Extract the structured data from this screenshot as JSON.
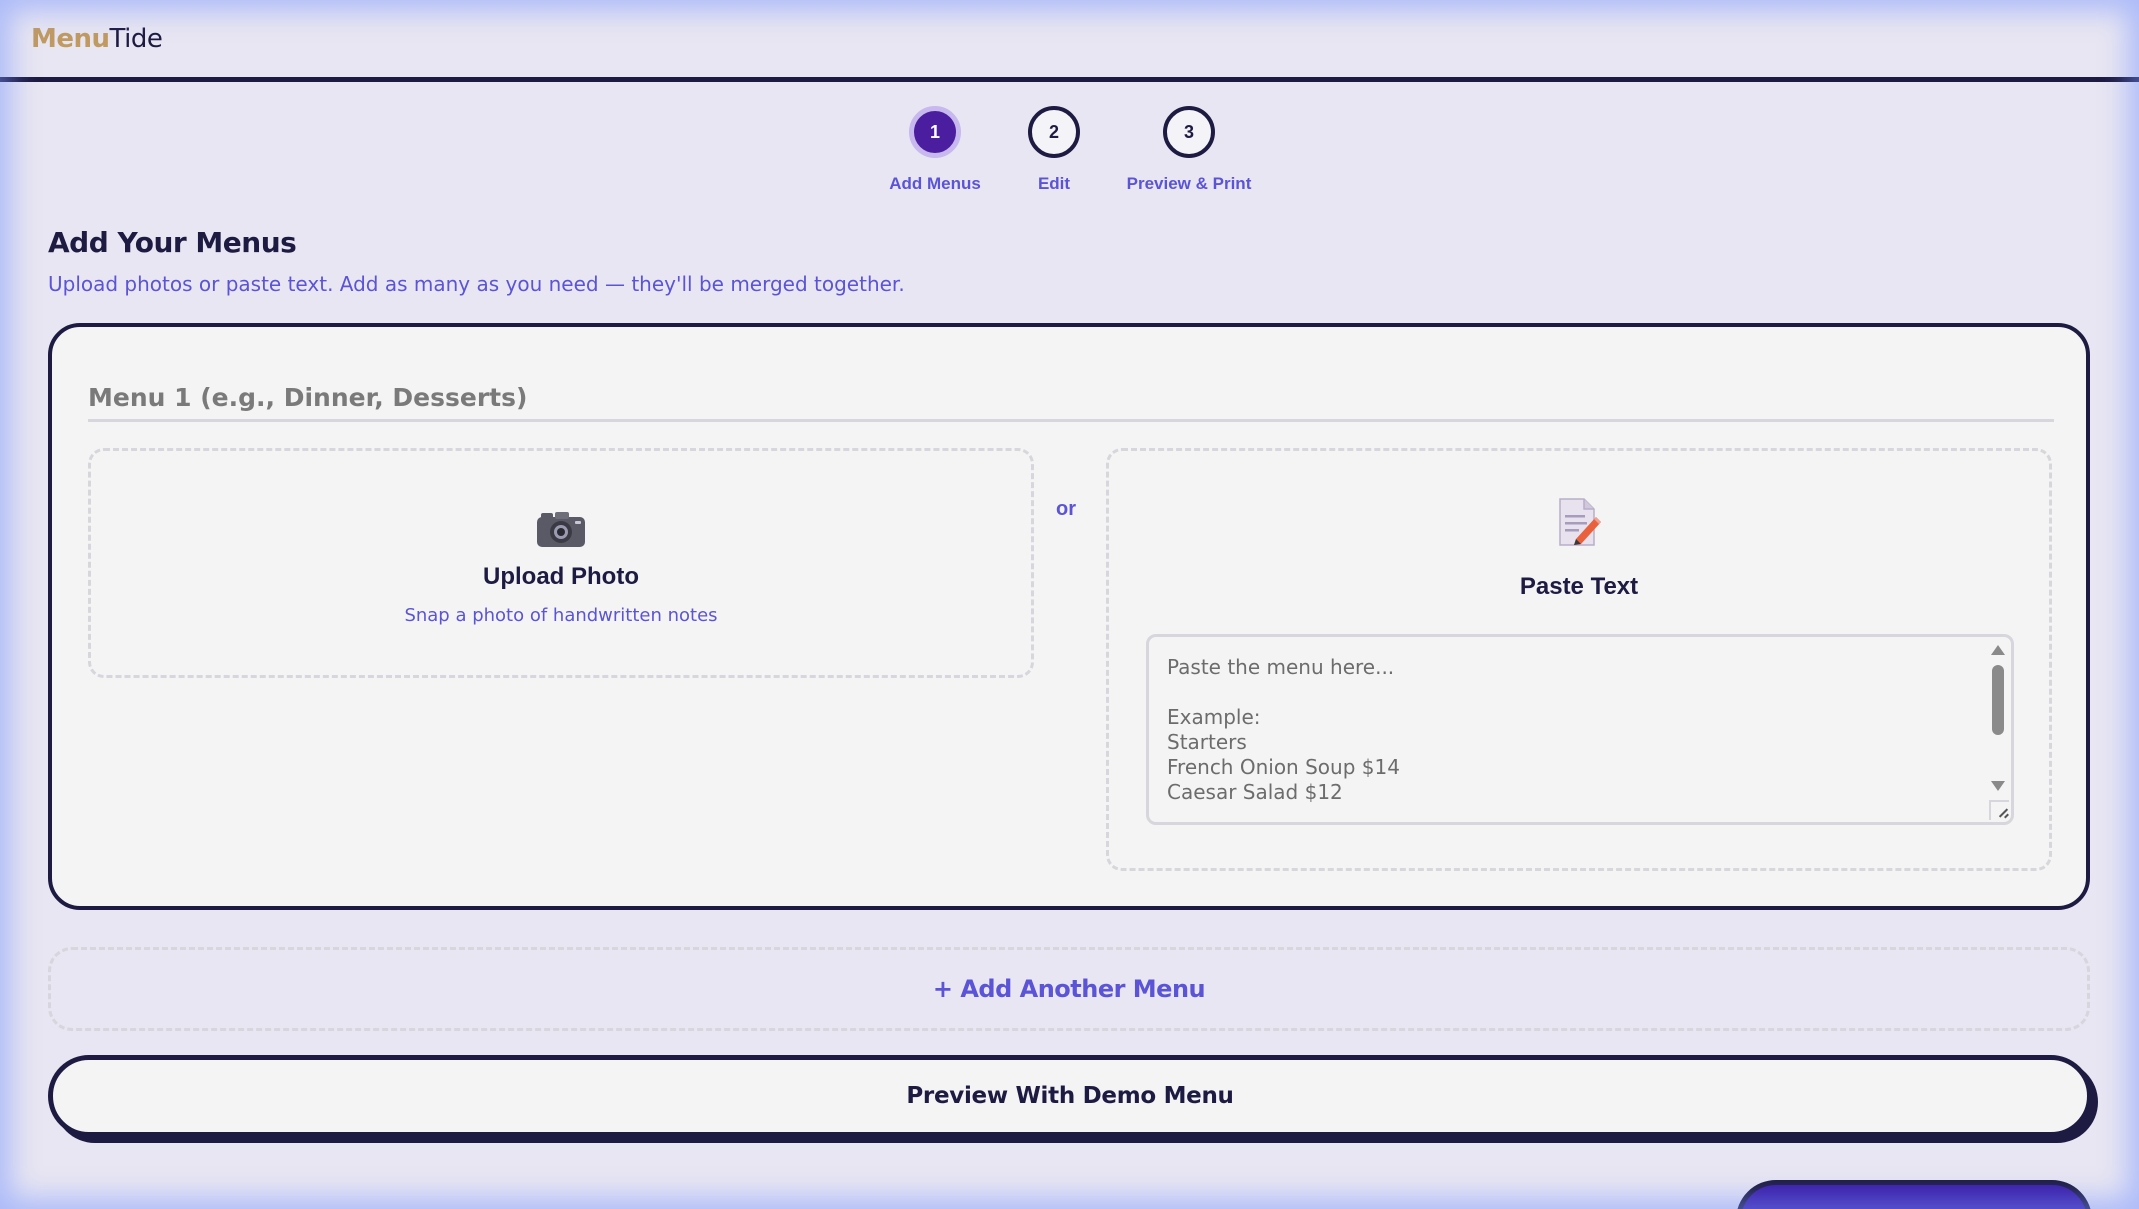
{
  "header": {
    "logo_part1": "Menu",
    "logo_part2": "Tide"
  },
  "stepper": {
    "steps": [
      {
        "number": "1",
        "label": "Add Menus",
        "active": true
      },
      {
        "number": "2",
        "label": "Edit",
        "active": false
      },
      {
        "number": "3",
        "label": "Preview & Print",
        "active": false
      }
    ]
  },
  "section": {
    "title": "Add Your Menus",
    "subtitle": "Upload photos or paste text. Add as many as you need — they'll be merged together."
  },
  "menu_card": {
    "name_placeholder": "Menu 1 (e.g., Dinner, Desserts)",
    "upload": {
      "icon": "camera-icon",
      "title": "Upload Photo",
      "hint": "Snap a photo of handwritten notes"
    },
    "or_label": "or",
    "paste": {
      "icon": "memo-icon",
      "title": "Paste Text",
      "placeholder": "Paste the menu here...\n\nExample:\nStarters\nFrench Onion Soup $14\nCaesar Salad $12"
    }
  },
  "actions": {
    "add_menu_label": "+ Add Another Menu",
    "demo_label": "Preview With Demo Menu"
  },
  "colors": {
    "accent": "#5b54d6",
    "navy": "#1e1b42",
    "active_step": "#4a1e9e",
    "logo_gold": "#c09a60"
  }
}
